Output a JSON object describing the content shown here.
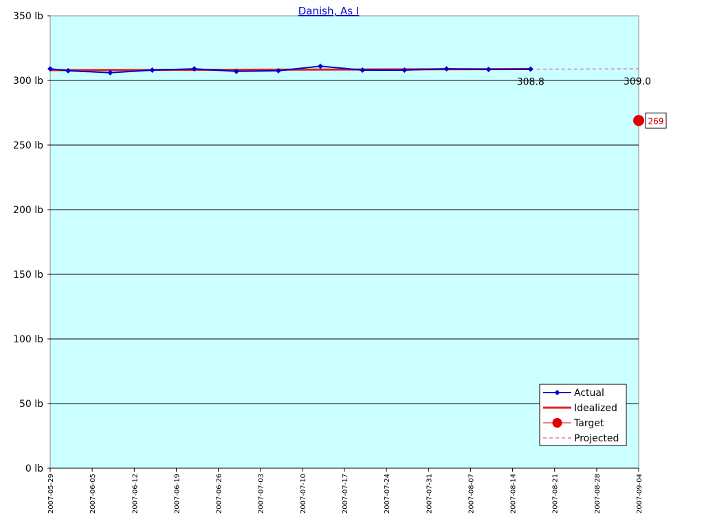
{
  "chart_data": {
    "type": "line",
    "title": "Danish, As I",
    "ylim": [
      0,
      350
    ],
    "yticks": [
      0,
      50,
      100,
      150,
      200,
      250,
      300,
      350
    ],
    "ytick_labels": [
      "0 lb",
      "50 lb",
      "100 lb",
      "150 lb",
      "200 lb",
      "250 lb",
      "300 lb",
      "350 lb"
    ],
    "xlim": [
      "2007-05-29",
      "2007-09-04"
    ],
    "xtick_labels": [
      "2007-05-29",
      "2007-06-05",
      "2007-06-12",
      "2007-06-19",
      "2007-06-26",
      "2007-07-03",
      "2007-07-10",
      "2007-07-17",
      "2007-07-24",
      "2007-07-31",
      "2007-08-07",
      "2007-08-14",
      "2007-08-21",
      "2007-08-28",
      "2007-09-04"
    ],
    "grid": true,
    "background_color": "#ccffff",
    "legend_position": "bottom-right",
    "series": [
      {
        "name": "Actual",
        "color": "#0000cc",
        "marker": "diamond",
        "x": [
          "2007-05-29",
          "2007-06-01",
          "2007-06-08",
          "2007-06-15",
          "2007-06-22",
          "2007-06-29",
          "2007-07-06",
          "2007-07-13",
          "2007-07-20",
          "2007-07-27",
          "2007-08-03",
          "2007-08-10",
          "2007-08-17"
        ],
        "y": [
          309.0,
          307.5,
          306.0,
          308.0,
          309.0,
          307.0,
          307.5,
          311.0,
          308.0,
          308.0,
          309.0,
          308.5,
          308.8
        ]
      },
      {
        "name": "Idealized",
        "color": "#dd2222",
        "x": [
          "2007-05-29",
          "2007-08-17"
        ],
        "y": [
          308.0,
          308.8
        ]
      },
      {
        "name": "Target",
        "color": "#dd0000",
        "marker": "circle",
        "x": [
          "2007-09-04"
        ],
        "y": [
          269
        ]
      },
      {
        "name": "Projected",
        "color": "#cc3399",
        "dashed": true,
        "x": [
          "2007-08-17",
          "2007-09-04"
        ],
        "y": [
          308.8,
          309.0
        ]
      }
    ],
    "annotations": [
      {
        "text": "308.8",
        "x": "2007-08-17",
        "y": 308.8
      },
      {
        "text": "309.0",
        "x": "2007-09-04",
        "y": 309.0
      }
    ],
    "target_label": "269"
  }
}
